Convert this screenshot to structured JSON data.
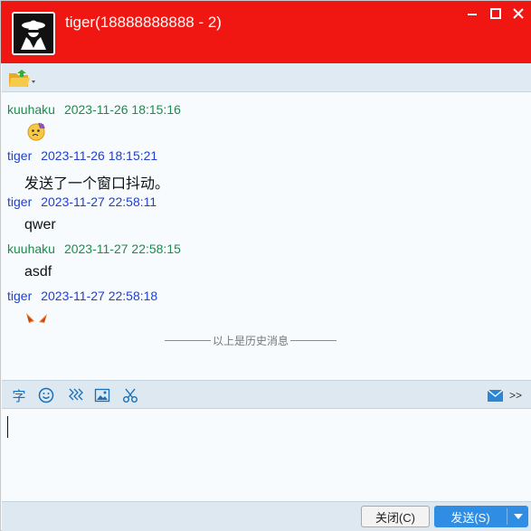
{
  "window": {
    "title": "tiger(18888888888 - 2)",
    "minimize_icon": "minimize-icon",
    "maximize_icon": "maximize-icon",
    "close_icon": "close-icon",
    "accent_color": "#f01612"
  },
  "toolbar": {
    "folder_icon": "folder-icon"
  },
  "messages": [
    {
      "sender": "kuuhaku",
      "time": "2023-11-26 18:15:16",
      "emoji": "embarrassed-face-emoji"
    },
    {
      "sender": "tiger",
      "time": "2023-11-26 18:15:21",
      "text": "发送了一个窗口抖动。"
    },
    {
      "sender": "tiger",
      "time": "2023-11-27 22:58:11",
      "text": "qwer"
    },
    {
      "sender": "kuuhaku",
      "time": "2023-11-27 22:58:15",
      "text": "asdf"
    },
    {
      "sender": "tiger",
      "time": "2023-11-27 22:58:18",
      "emoji": "fox-sticker"
    }
  ],
  "history_divider": "以上是历史消息",
  "input_toolbar": {
    "font_label": "字",
    "icons": [
      "smiley-icon",
      "shake-icon",
      "image-icon",
      "scissors-icon",
      "mail-icon",
      "more-icon"
    ],
    "more_label": ">>"
  },
  "footer": {
    "close_label": "关闭(C)",
    "send_label": "发送(S)"
  },
  "colors": {
    "other_sender": "#1f8a4c",
    "self_sender": "#1e3fcf",
    "send_button": "#2f8de4"
  }
}
